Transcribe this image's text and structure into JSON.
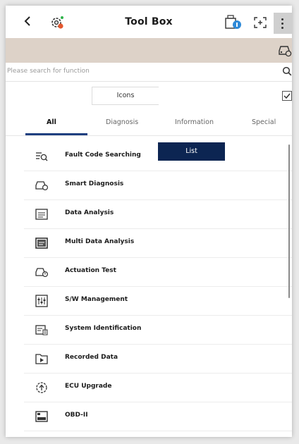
{
  "header": {
    "title": "Tool Box",
    "back_icon": "chevron-left-icon",
    "settings_icon": "gear-icon",
    "ecu_icon": "ecu-info-icon",
    "fit_icon": "fit-screen-icon",
    "more_icon": "more-vertical-icon"
  },
  "banner": {
    "vehicle_icon": "vehicle-icon",
    "color": "#ddd2c8"
  },
  "search": {
    "placeholder": "Please search for function",
    "icon": "search-icon"
  },
  "view_toggle": {
    "icons_label": "Icons",
    "list_label": "List",
    "selected": "List"
  },
  "tabs": [
    {
      "label": "All",
      "selected": true
    },
    {
      "label": "Diagnosis",
      "selected": false
    },
    {
      "label": "Information",
      "selected": false
    },
    {
      "label": "Special",
      "selected": false
    }
  ],
  "items": [
    {
      "label": "Fault Code Searching",
      "icon": "fault-code-search-icon"
    },
    {
      "label": "Smart Diagnosis",
      "icon": "smart-diagnosis-icon"
    },
    {
      "label": "Data Analysis",
      "icon": "data-analysis-icon"
    },
    {
      "label": "Multi Data Analysis",
      "icon": "multi-data-analysis-icon"
    },
    {
      "label": "Actuation Test",
      "icon": "actuation-test-icon"
    },
    {
      "label": "S/W Management",
      "icon": "sw-management-icon"
    },
    {
      "label": "System Identification",
      "icon": "system-identification-icon"
    },
    {
      "label": "Recorded Data",
      "icon": "recorded-data-icon"
    },
    {
      "label": "ECU Upgrade",
      "icon": "ecu-upgrade-icon"
    },
    {
      "label": "OBD-II",
      "icon": "obd-ii-icon"
    }
  ],
  "colors": {
    "accent": "#0c2552",
    "tab_underline": "#1e3f80"
  }
}
